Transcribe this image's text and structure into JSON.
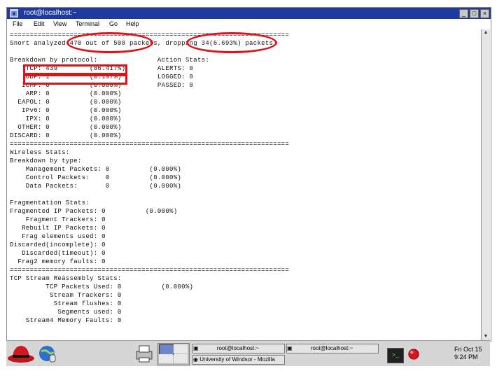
{
  "window": {
    "title": "root@localhost:~"
  },
  "menu": [
    "File",
    "Edit",
    "View",
    "Terminal",
    "Go",
    "Help"
  ],
  "terminal_lines": [
    "======================================================================",
    "Snort analyzed 470 out of 508 packets, dropping 34(6.693%) packets",
    "",
    "Breakdown by protocol:               Action Stats:",
    "    TCP: 439        (86.417%)        ALERTS: 0",
    "    UDP: 1          (0.197%)         LOGGED: 0",
    "   ICMP: 0          (0.000%)         PASSED: 0",
    "    ARP: 0          (0.000%)",
    "  EAPOL: 0          (0.000%)",
    "   IPv6: 0          (0.000%)",
    "    IPX: 0          (0.000%)",
    "  OTHER: 0          (0.000%)",
    "DISCARD: 0          (0.000%)",
    "======================================================================",
    "Wireless Stats:",
    "Breakdown by type:",
    "    Management Packets: 0          (0.000%)",
    "    Control Packets:    0          (0.000%)",
    "    Data Packets:       0          (0.000%)",
    "",
    "Fragmentation Stats:",
    "Fragmented IP Packets: 0          (0.000%)",
    "    Fragment Trackers: 0",
    "   Rebuilt IP Packets: 0",
    "   Frag elements used: 0",
    "Discarded(incomplete): 0",
    "   Discarded(timeout): 0",
    "  Frag2 memory faults: 0",
    "======================================================================",
    "TCP Stream Reassembly Stats:",
    "         TCP Packets Used: 0          (0.000%)",
    "          Stream Trackers: 0",
    "           Stream flushes: 0",
    "            Segments used: 0",
    "    Stream4 Memory Faults: 0"
  ],
  "taskbar": {
    "tasks": [
      "root@localhost:~",
      "root@localhost:~",
      "University of Windsor - Mozilla"
    ],
    "clock": {
      "day": "Fri Oct 15",
      "time": "9:24 PM"
    }
  },
  "colors": {
    "titlebar": "#1f3a9e",
    "highlight": "#d9141d",
    "taskbar": "#d6d6d6"
  }
}
